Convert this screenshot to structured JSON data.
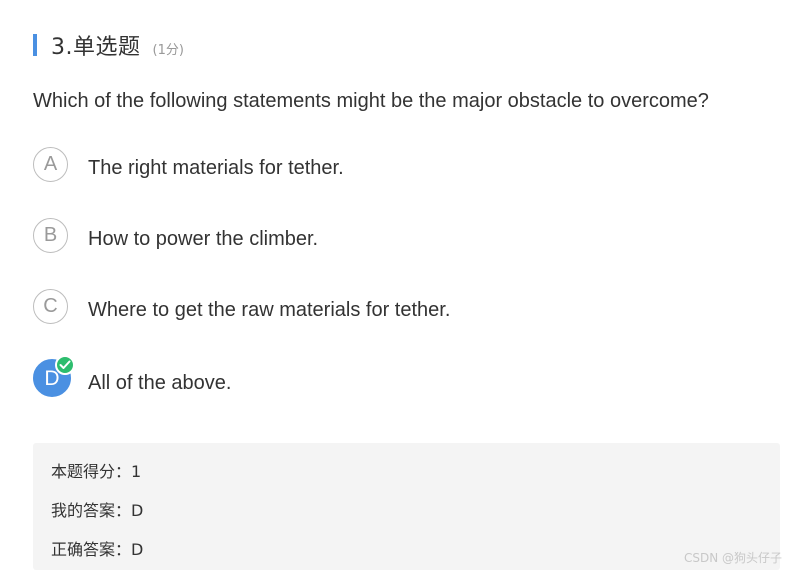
{
  "question": {
    "title": "3.单选题",
    "score": "(1分)",
    "text": "Which of the following statements might be the major obstacle to overcome?"
  },
  "options": [
    {
      "letter": "A",
      "text": "The right materials for tether.",
      "selected": false
    },
    {
      "letter": "B",
      "text": "How to power the climber.",
      "selected": false
    },
    {
      "letter": "C",
      "text": "Where to get the raw materials for tether.",
      "selected": false
    },
    {
      "letter": "D",
      "text": "All of the above.",
      "selected": true
    }
  ],
  "result": {
    "score_line": "本题得分：1",
    "my_answer_line": "我的答案：D",
    "correct_answer_line": "正确答案：D"
  },
  "watermark": "CSDN @狗头仔子",
  "colors": {
    "accent": "#4a90e2",
    "correct": "#2dbd6e",
    "result_bg": "#f4f4f4"
  },
  "icons": {
    "selected_badge": "check-icon"
  }
}
